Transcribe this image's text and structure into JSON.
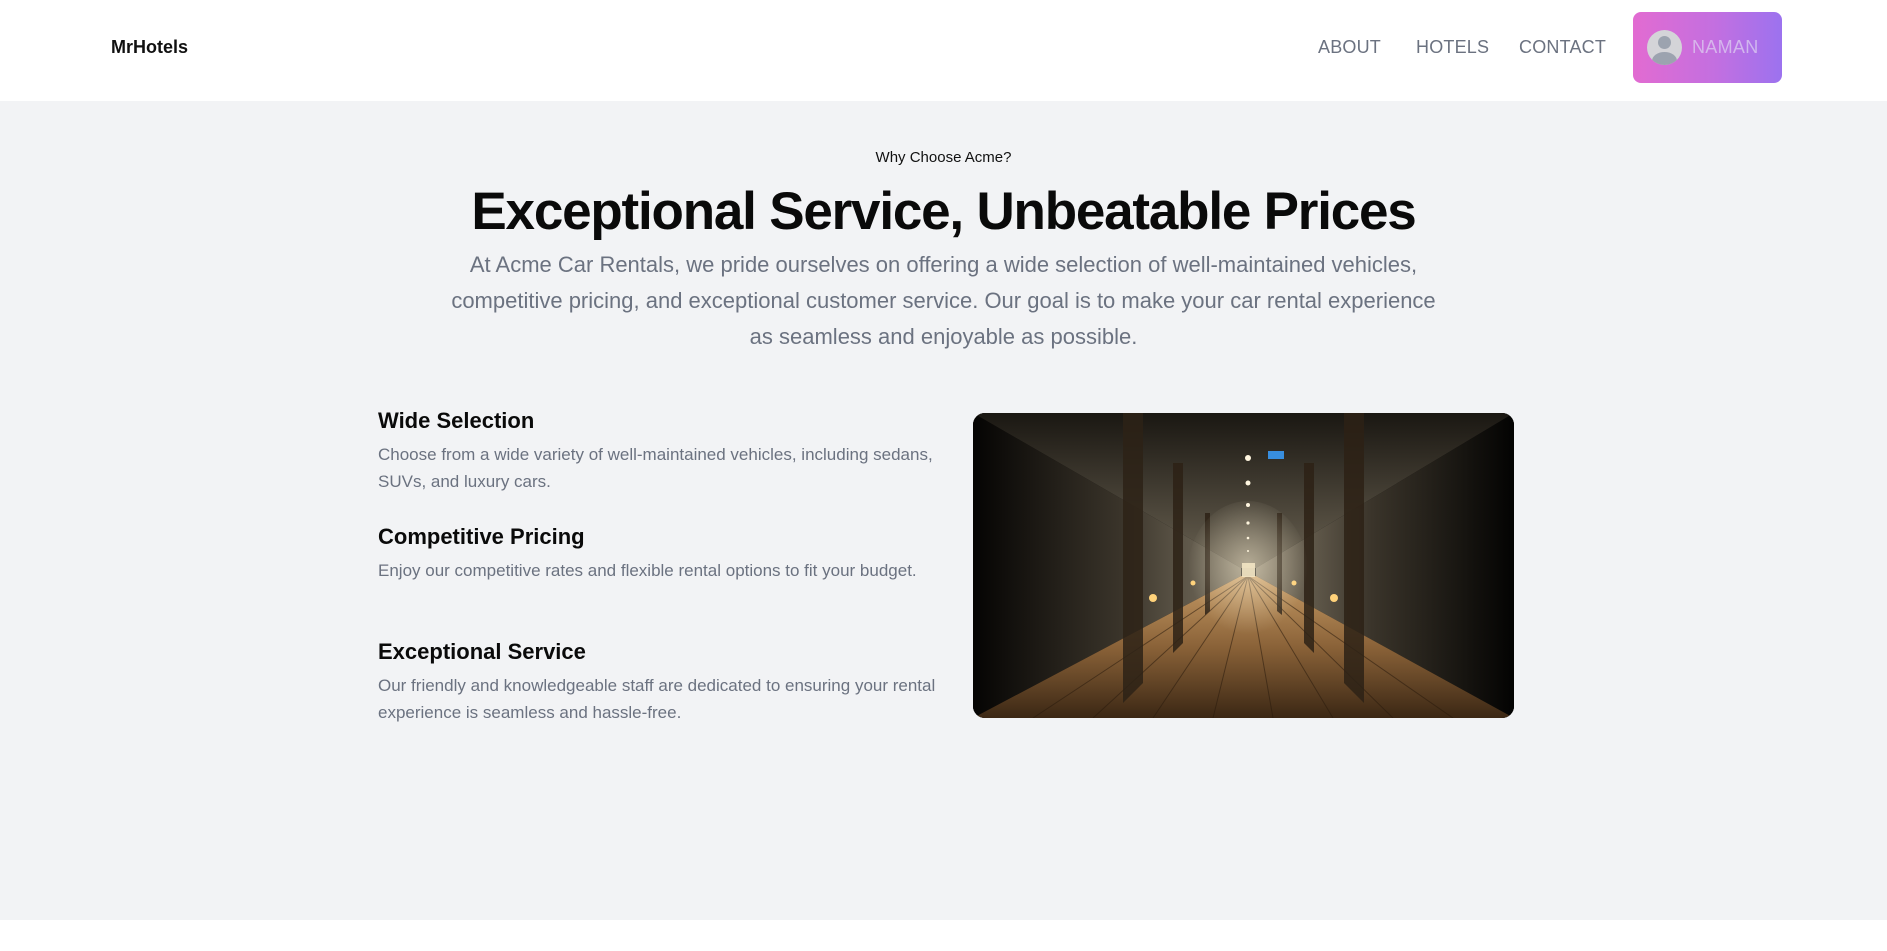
{
  "header": {
    "brand": "MrHotels",
    "nav": {
      "about": "ABOUT",
      "hotels": "HOTELS",
      "contact": "CONTACT"
    },
    "user": {
      "name": "NAMAN",
      "avatar_icon": "user-avatar-icon"
    }
  },
  "hero": {
    "eyebrow": "Why Choose Acme?",
    "title": "Exceptional Service, Unbeatable Prices",
    "description": "At Acme Car Rentals, we pride ourselves on offering a wide selection of well-maintained vehicles, competitive pricing, and exceptional customer service. Our goal is to make your car rental experience as seamless and enjoyable as possible."
  },
  "features": [
    {
      "title": "Wide Selection",
      "description": "Choose from a wide variety of well-maintained vehicles, including sedans, SUVs, and luxury cars."
    },
    {
      "title": "Competitive Pricing",
      "description": "Enjoy our competitive rates and flexible rental options to fit your budget."
    },
    {
      "title": "Exceptional Service",
      "description": "Our friendly and knowledgeable staff are dedicated to ensuring your rental experience is seamless and hassle-free."
    }
  ],
  "colors": {
    "section_background": "#f2f3f5",
    "user_button_gradient_start": "#e26bd1",
    "user_button_gradient_end": "#9c72ef",
    "muted_text": "#6b7280"
  }
}
